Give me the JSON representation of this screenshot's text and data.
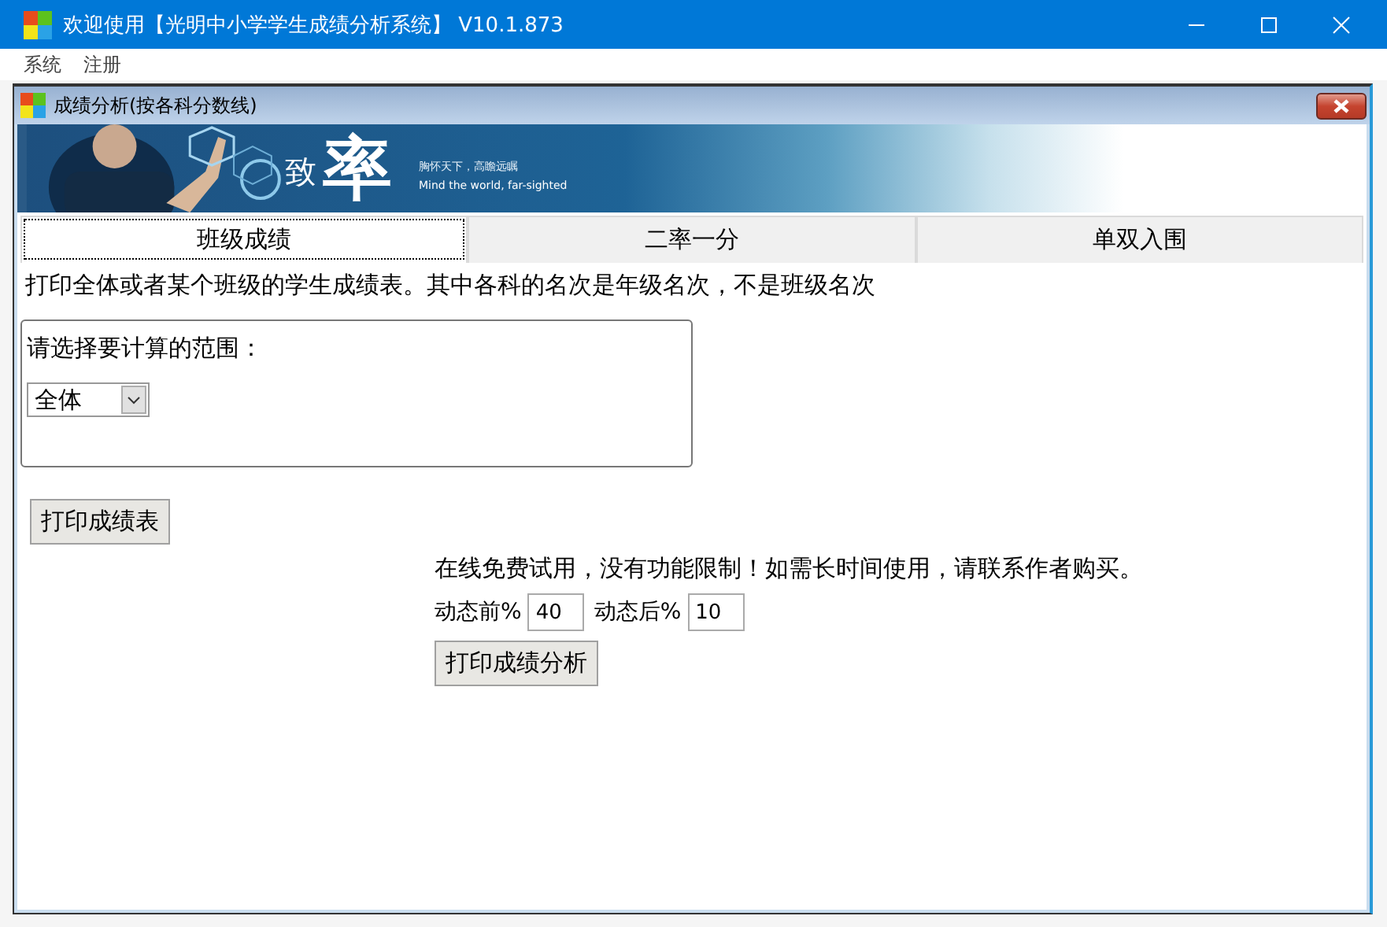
{
  "main_window": {
    "title": "欢迎使用【光明中小学学生成绩分析系统】 V10.1.873"
  },
  "menu": [
    {
      "label": "系统"
    },
    {
      "label": "注册"
    }
  ],
  "child_window": {
    "title": "成绩分析(按各科分数线)"
  },
  "banner": {
    "logo_small": "致",
    "logo_large": "率",
    "slogan": "胸怀天下，高瞻远瞩",
    "slogan_en": "Mind the world, far-sighted"
  },
  "tabs": [
    {
      "label": "班级成绩",
      "selected": true
    },
    {
      "label": "二率一分",
      "selected": false
    },
    {
      "label": "单双入围",
      "selected": false
    }
  ],
  "description": "打印全体或者某个班级的学生成绩表。其中各科的名次是年级名次，不是班级名次",
  "range_group": {
    "label": "请选择要计算的范围：",
    "value": "全体"
  },
  "print_table_button": "打印成绩表",
  "trial_notice": "在线免费试用，没有功能限制！如需长时间使用，请联系作者购买。",
  "fields": [
    {
      "label": "动态前%",
      "value": "40"
    },
    {
      "label": "动态后%",
      "value": "10"
    }
  ],
  "print_analysis_button": "打印成绩分析"
}
